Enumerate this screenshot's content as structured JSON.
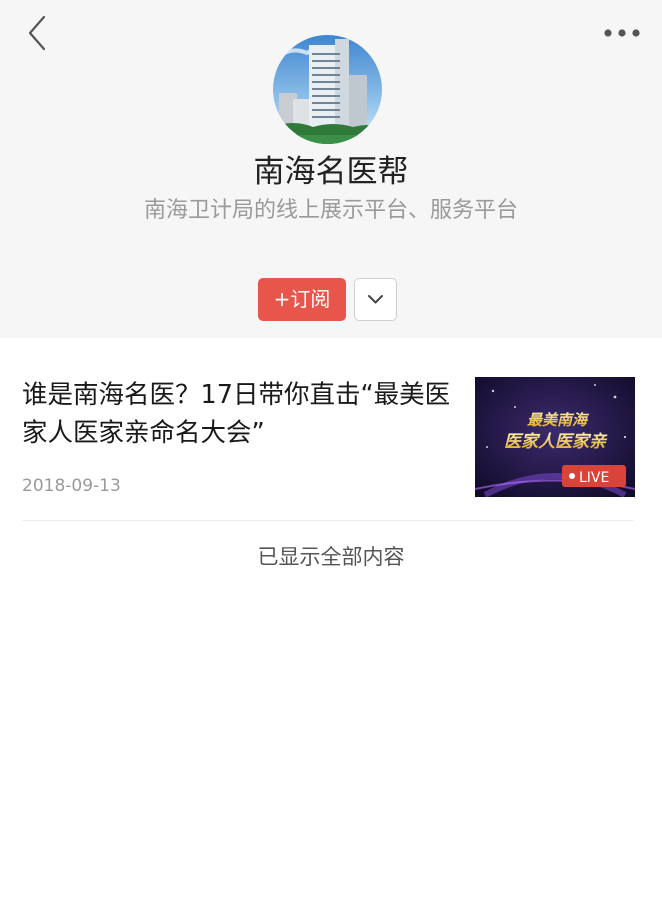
{
  "nav": {
    "back_icon": "chevron-left-icon",
    "more_icon": "more-dots-icon"
  },
  "profile": {
    "avatar_icon": "building-avatar",
    "name": "南海名医帮",
    "description": "南海卫计局的线上展示平台、服务平台",
    "subscribe_label": "+订阅",
    "dropdown_icon": "chevron-down-icon",
    "accent_color": "#e8554b"
  },
  "articles": [
    {
      "title": "谁是南海名医？17日带你直击“最美医家人医家亲命名大会”",
      "date": "2018-09-13",
      "thumbnail": {
        "line1": "最美南海",
        "line2": "医家人医家亲",
        "live_badge": "LIVE"
      }
    }
  ],
  "footer": {
    "end_text": "已显示全部内容"
  }
}
